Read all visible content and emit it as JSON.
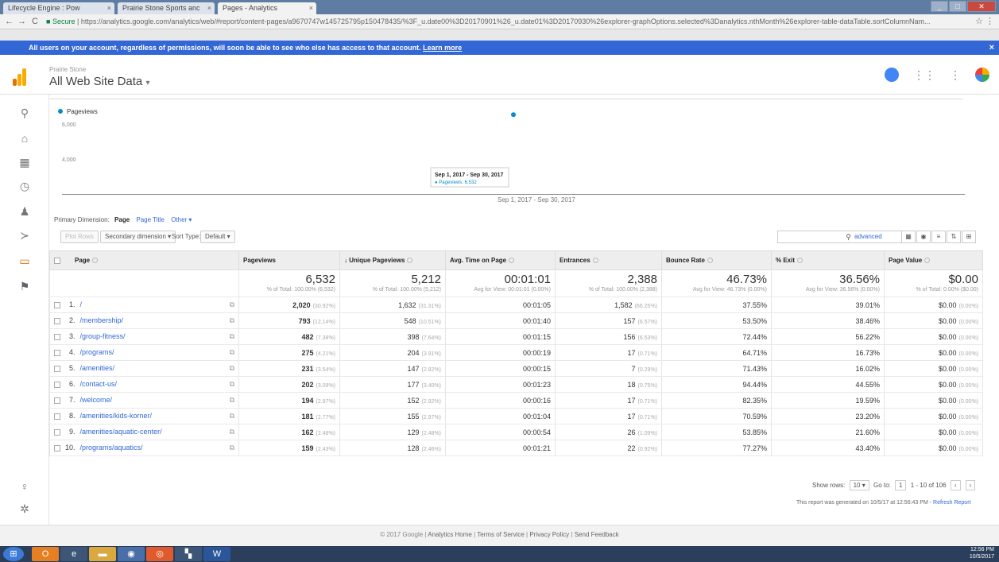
{
  "browser": {
    "tabs": [
      {
        "label": "Lifecycle Engine : Pow"
      },
      {
        "label": "Prairie Stone Sports anc"
      },
      {
        "label": "Pages - Analytics"
      }
    ],
    "tab_close": "×",
    "url_secure": "Secure",
    "url": "https://analytics.google.com/analytics/web/#report/content-pages/a9670747w145725795p150478435/%3F_u.date00%3D20170901%26_u.date01%3D20170930%26explorer-graphOptions.selected%3Danalytics.nthMonth%26explorer-table-dataTable.sortColumnNam..."
  },
  "notice": {
    "text": "All users on your account, regardless of permissions, will soon be able to see who else has access to that account.",
    "link": "Learn more",
    "close": "×"
  },
  "header": {
    "account_small": "Prairie Stone",
    "view_name": "All Web Site Data"
  },
  "chart": {
    "legend": "Pageviews",
    "ytick_high": "6,000",
    "ytick_low": "4,000",
    "tooltip_date": "Sep 1, 2017 - Sep 30, 2017",
    "tooltip_value": "● Pageviews: 6,532",
    "timeline_label": "Sep 1, 2017 - Sep 30, 2017"
  },
  "chart_data": {
    "type": "scatter",
    "x": [
      "Sep 1, 2017 - Sep 30, 2017"
    ],
    "series": [
      {
        "name": "Pageviews",
        "values": [
          6532
        ]
      }
    ],
    "yticks": [
      4000,
      6000
    ],
    "accent": "#058dc7"
  },
  "dimensions": {
    "label": "Primary Dimension:",
    "active": "Page",
    "page_title": "Page Title",
    "other": "Other ▾"
  },
  "toolbar": {
    "plot_rows": "Plot Rows",
    "secondary": "Secondary dimension ▾",
    "sort_label": "Sort Type:",
    "sort_value": "Default ▾",
    "advanced": "advanced"
  },
  "table": {
    "headers": [
      "Page",
      "Pageviews",
      "Unique Pageviews",
      "Avg. Time on Page",
      "Entrances",
      "Bounce Rate",
      "% Exit",
      "Page Value"
    ],
    "totals": {
      "pageviews": "6,532",
      "pageviews_sub": "% of Total: 100.00% (6,532)",
      "unique": "5,212",
      "unique_sub": "% of Total: 100.00% (5,212)",
      "time": "00:01:01",
      "time_sub": "Avg for View: 00:01:01 (0.00%)",
      "entrances": "2,388",
      "entrances_sub": "% of Total: 100.00% (2,388)",
      "bounce": "46.73%",
      "bounce_sub": "Avg for View: 46.73% (0.00%)",
      "exit": "36.56%",
      "exit_sub": "Avg for View: 36.56% (0.00%)",
      "value": "$0.00",
      "value_sub": "% of Total: 0.00% ($0.00)"
    },
    "rows": [
      {
        "idx": "1.",
        "page": "/",
        "pv": "2,020",
        "pv_pct": "(30.92%)",
        "upv": "1,632",
        "upv_pct": "(31.31%)",
        "time": "00:01:05",
        "ent": "1,582",
        "ent_pct": "(66.25%)",
        "bounce": "37.55%",
        "exit": "39.01%",
        "val": "$0.00",
        "val_pct": "(0.00%)"
      },
      {
        "idx": "2.",
        "page": "/membership/",
        "pv": "793",
        "pv_pct": "(12.14%)",
        "upv": "548",
        "upv_pct": "(10.51%)",
        "time": "00:01:40",
        "ent": "157",
        "ent_pct": "(6.57%)",
        "bounce": "53.50%",
        "exit": "38.46%",
        "val": "$0.00",
        "val_pct": "(0.00%)"
      },
      {
        "idx": "3.",
        "page": "/group-fitness/",
        "pv": "482",
        "pv_pct": "(7.38%)",
        "upv": "398",
        "upv_pct": "(7.64%)",
        "time": "00:01:15",
        "ent": "156",
        "ent_pct": "(6.53%)",
        "bounce": "72.44%",
        "exit": "56.22%",
        "val": "$0.00",
        "val_pct": "(0.00%)"
      },
      {
        "idx": "4.",
        "page": "/programs/",
        "pv": "275",
        "pv_pct": "(4.21%)",
        "upv": "204",
        "upv_pct": "(3.91%)",
        "time": "00:00:19",
        "ent": "17",
        "ent_pct": "(0.71%)",
        "bounce": "64.71%",
        "exit": "16.73%",
        "val": "$0.00",
        "val_pct": "(0.00%)"
      },
      {
        "idx": "5.",
        "page": "/amenities/",
        "pv": "231",
        "pv_pct": "(3.54%)",
        "upv": "147",
        "upv_pct": "(2.82%)",
        "time": "00:00:15",
        "ent": "7",
        "ent_pct": "(0.29%)",
        "bounce": "71.43%",
        "exit": "16.02%",
        "val": "$0.00",
        "val_pct": "(0.00%)"
      },
      {
        "idx": "6.",
        "page": "/contact-us/",
        "pv": "202",
        "pv_pct": "(3.09%)",
        "upv": "177",
        "upv_pct": "(3.40%)",
        "time": "00:01:23",
        "ent": "18",
        "ent_pct": "(0.75%)",
        "bounce": "94.44%",
        "exit": "44.55%",
        "val": "$0.00",
        "val_pct": "(0.00%)"
      },
      {
        "idx": "7.",
        "page": "/welcome/",
        "pv": "194",
        "pv_pct": "(2.97%)",
        "upv": "152",
        "upv_pct": "(2.92%)",
        "time": "00:00:16",
        "ent": "17",
        "ent_pct": "(0.71%)",
        "bounce": "82.35%",
        "exit": "19.59%",
        "val": "$0.00",
        "val_pct": "(0.00%)"
      },
      {
        "idx": "8.",
        "page": "/amenities/kids-korner/",
        "pv": "181",
        "pv_pct": "(2.77%)",
        "upv": "155",
        "upv_pct": "(2.97%)",
        "time": "00:01:04",
        "ent": "17",
        "ent_pct": "(0.71%)",
        "bounce": "70.59%",
        "exit": "23.20%",
        "val": "$0.00",
        "val_pct": "(0.00%)"
      },
      {
        "idx": "9.",
        "page": "/amenities/aquatic-center/",
        "pv": "162",
        "pv_pct": "(2.48%)",
        "upv": "129",
        "upv_pct": "(2.48%)",
        "time": "00:00:54",
        "ent": "26",
        "ent_pct": "(1.09%)",
        "bounce": "53.85%",
        "exit": "21.60%",
        "val": "$0.00",
        "val_pct": "(0.00%)"
      },
      {
        "idx": "10.",
        "page": "/programs/aquatics/",
        "pv": "159",
        "pv_pct": "(2.43%)",
        "upv": "128",
        "upv_pct": "(2.46%)",
        "time": "00:01:21",
        "ent": "22",
        "ent_pct": "(0.92%)",
        "bounce": "77.27%",
        "exit": "43.40%",
        "val": "$0.00",
        "val_pct": "(0.00%)"
      }
    ]
  },
  "pager": {
    "show_rows": "Show rows:",
    "rows_value": "10 ▾",
    "goto": "Go to:",
    "goto_value": "1",
    "range": "1 - 10 of 106",
    "prev": "‹",
    "next": "›"
  },
  "generated": {
    "text": "This report was generated on 10/5/17 at 12:56:43 PM -",
    "refresh": "Refresh Report"
  },
  "footer": {
    "copyright": "© 2017 Google |",
    "home": "Analytics Home",
    "terms": "Terms of Service",
    "privacy": "Privacy Policy",
    "feedback": "Send Feedback",
    "sep": "|"
  },
  "taskbar": {
    "time": "12:56 PM",
    "date": "10/5/2017"
  }
}
